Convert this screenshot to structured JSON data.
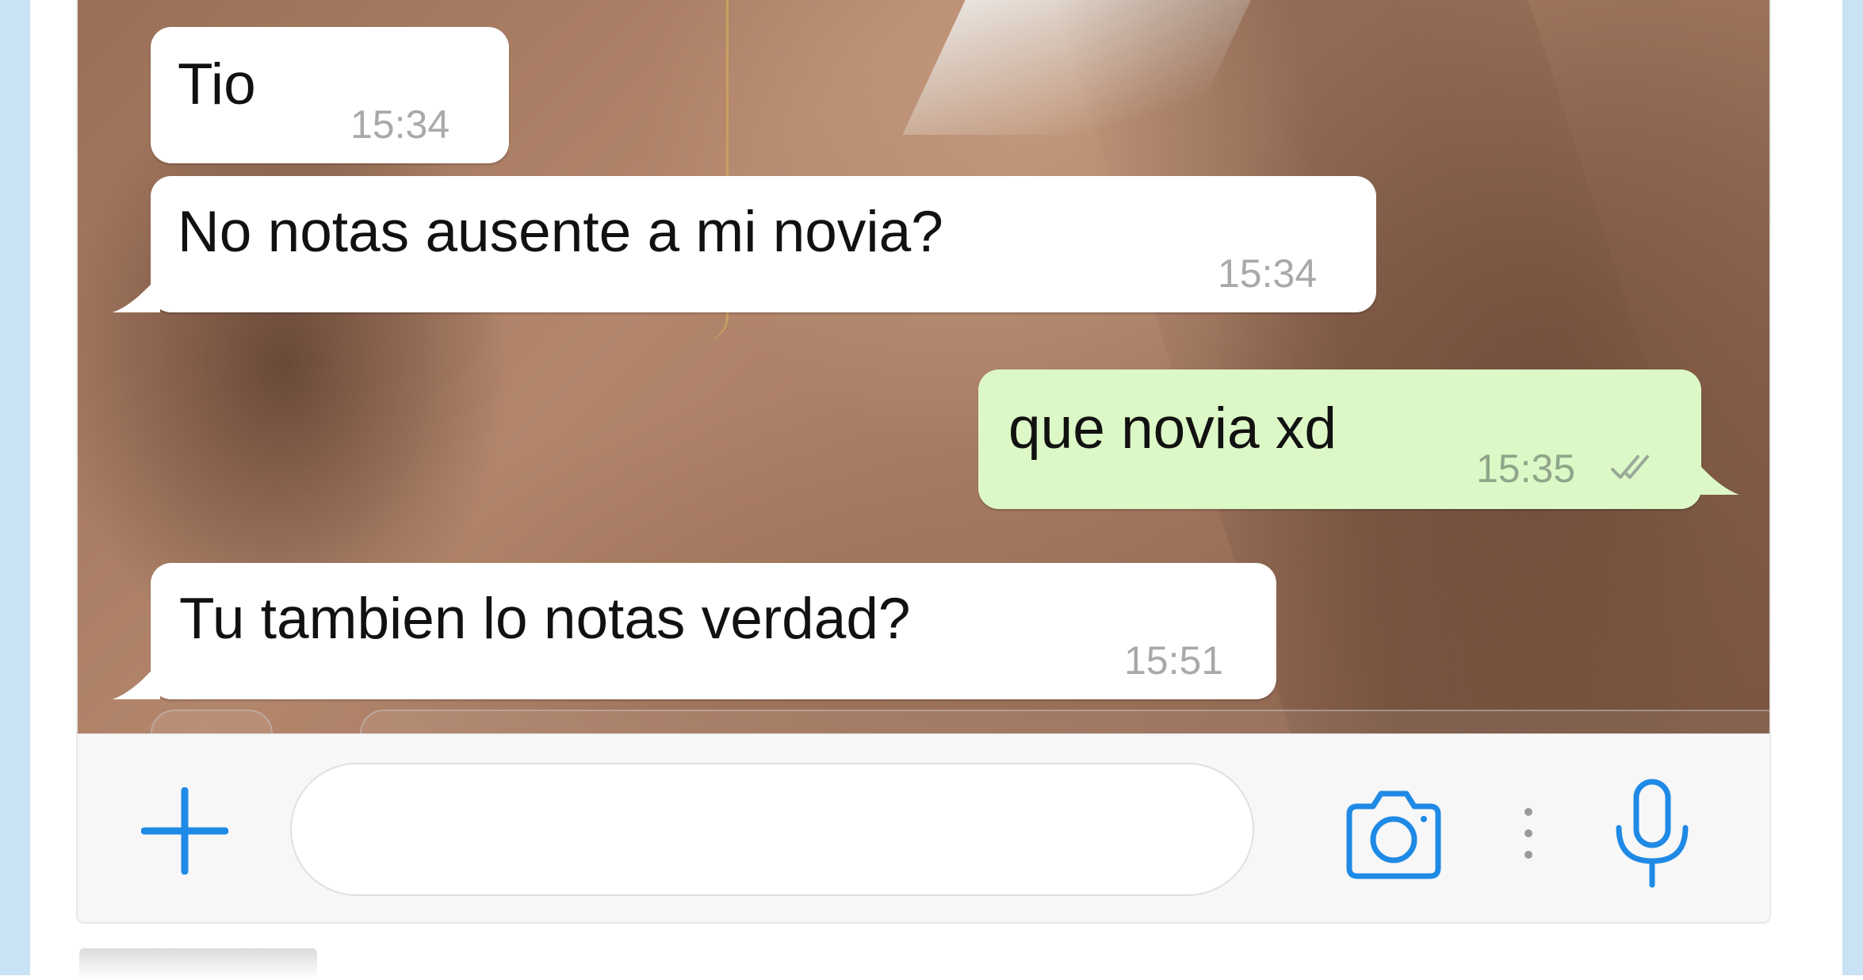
{
  "messages": [
    {
      "direction": "incoming",
      "text": "Tio",
      "time": "15:34"
    },
    {
      "direction": "incoming",
      "text": "No notas ausente a mi novia?",
      "time": "15:34"
    },
    {
      "direction": "outgoing",
      "text": "que novia xd",
      "time": "15:35",
      "status": "read-double-check-icon"
    },
    {
      "direction": "incoming",
      "text": "Tu tambien lo notas verdad?",
      "time": "15:51"
    }
  ],
  "composer": {
    "value": "",
    "placeholder": ""
  },
  "icons": {
    "attach": "plus-icon",
    "camera": "camera-icon",
    "more": "vertical-dots-icon",
    "voice": "microphone-icon"
  },
  "colors": {
    "incoming_bubble": "#ffffff",
    "outgoing_bubble": "#dcf8c6",
    "accent_blue": "#1f8ae6",
    "page_side": "#c9e2f4"
  }
}
